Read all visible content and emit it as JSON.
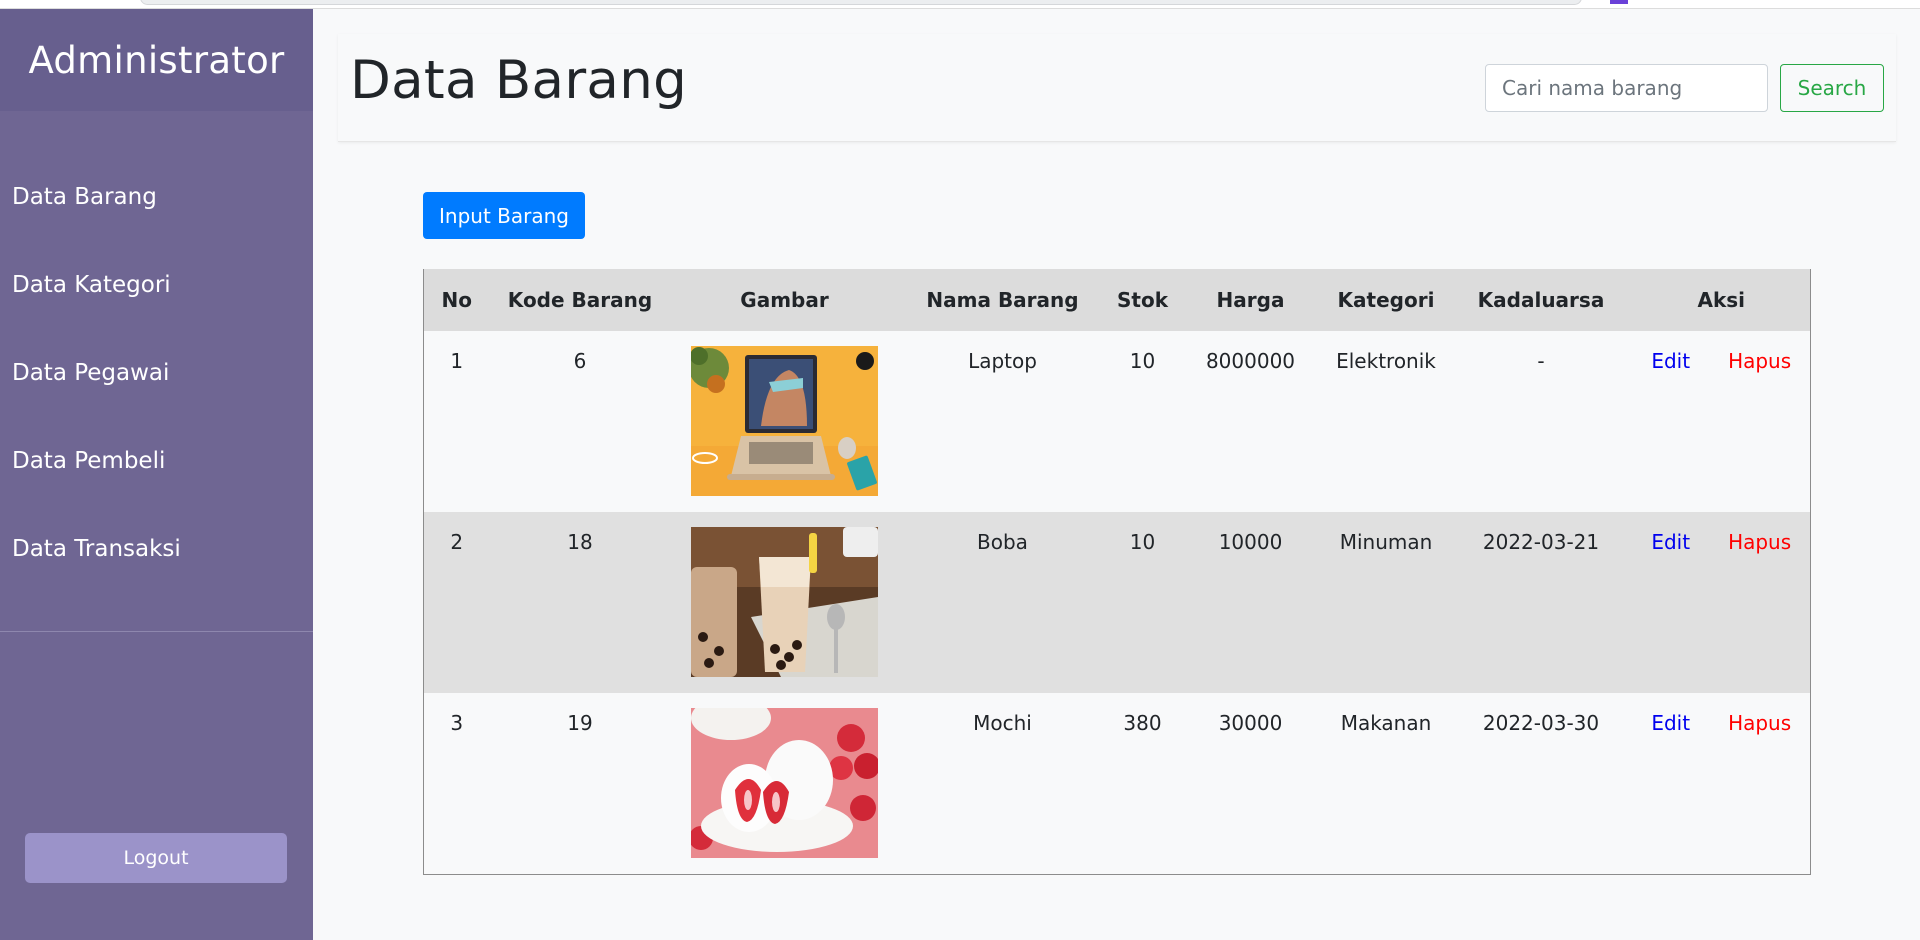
{
  "sidebar": {
    "brand": "Administrator",
    "items": [
      {
        "label": "Data Barang"
      },
      {
        "label": "Data Kategori"
      },
      {
        "label": "Data Pegawai"
      },
      {
        "label": "Data Pembeli"
      },
      {
        "label": "Data Transaksi"
      }
    ],
    "logout_label": "Logout"
  },
  "header": {
    "title": "Data Barang",
    "search_placeholder": "Cari nama barang",
    "search_label": "Search"
  },
  "main": {
    "input_button_label": "Input Barang",
    "table": {
      "columns": [
        "No",
        "Kode Barang",
        "Gambar",
        "Nama Barang",
        "Stok",
        "Harga",
        "Kategori",
        "Kadaluarsa",
        "Aksi"
      ],
      "rows": [
        {
          "no": "1",
          "kode": "6",
          "gambar": "laptop-image",
          "nama": "Laptop",
          "stok": "10",
          "harga": "8000000",
          "kategori": "Elektronik",
          "kadaluarsa": "-",
          "edit": "Edit",
          "hapus": "Hapus"
        },
        {
          "no": "2",
          "kode": "18",
          "gambar": "boba-image",
          "nama": "Boba",
          "stok": "10",
          "harga": "10000",
          "kategori": "Minuman",
          "kadaluarsa": "2022-03-21",
          "edit": "Edit",
          "hapus": "Hapus"
        },
        {
          "no": "3",
          "kode": "19",
          "gambar": "mochi-image",
          "nama": "Mochi",
          "stok": "380",
          "harga": "30000",
          "kategori": "Makanan",
          "kadaluarsa": "2022-03-30",
          "edit": "Edit",
          "hapus": "Hapus"
        }
      ]
    }
  },
  "colors": {
    "sidebar_bg": "#6f6693",
    "brand_bg": "#675f8e",
    "logout_bg": "#9b93c9",
    "primary": "#007bff",
    "success": "#28a745",
    "edit_link": "#0000ee",
    "delete_link": "#ff0000"
  }
}
